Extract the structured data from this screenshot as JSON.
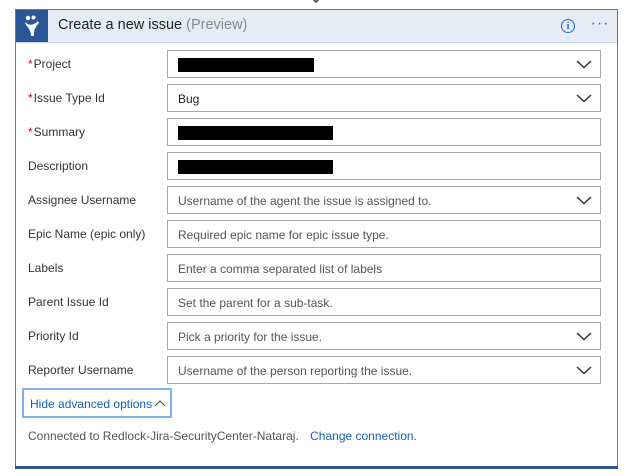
{
  "card": {
    "title": "Create a new issue",
    "title_suffix": "(Preview)",
    "info_icon": "info-icon",
    "more_icon": "more-icon",
    "more_glyph": "···",
    "info_glyph": "i"
  },
  "fields": [
    {
      "label": "Project",
      "required": true,
      "value": "",
      "redacted": true,
      "dropdown": true
    },
    {
      "label": "Issue Type Id",
      "required": true,
      "value": "Bug",
      "redacted": false,
      "dropdown": true
    },
    {
      "label": "Summary",
      "required": true,
      "value": "",
      "redacted": true,
      "dropdown": false
    },
    {
      "label": "Description",
      "required": false,
      "value": "",
      "redacted": true,
      "dropdown": false
    },
    {
      "label": "Assignee Username",
      "required": false,
      "placeholder": "Username of the agent the issue is assigned to.",
      "dropdown": true
    },
    {
      "label": "Epic Name (epic only)",
      "required": false,
      "placeholder": "Required epic name for epic issue type.",
      "dropdown": false
    },
    {
      "label": "Labels",
      "required": false,
      "placeholder": "Enter a comma separated list of labels",
      "dropdown": false
    },
    {
      "label": "Parent Issue Id",
      "required": false,
      "placeholder": "Set the parent for a sub-task.",
      "dropdown": false
    },
    {
      "label": "Priority Id",
      "required": false,
      "placeholder": "Pick a priority for the issue.",
      "dropdown": true
    },
    {
      "label": "Reporter Username",
      "required": false,
      "placeholder": "Username of the person reporting the issue.",
      "dropdown": true
    }
  ],
  "required_marker": "*",
  "advanced": {
    "label": "Hide advanced options"
  },
  "connection": {
    "text": "Connected to Redlock-Jira-SecurityCenter-Nataraj.",
    "link": "Change connection."
  },
  "colors": {
    "accent": "#2b5797",
    "link": "#1a5fb4",
    "required": "#d0021b"
  }
}
